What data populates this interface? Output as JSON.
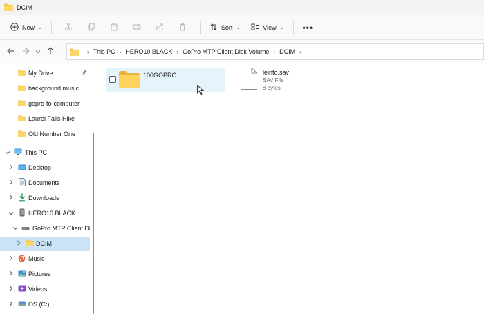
{
  "window": {
    "title": "DCIM"
  },
  "toolbar": {
    "new_label": "New",
    "sort_label": "Sort",
    "view_label": "View",
    "more_label": "•••"
  },
  "address": {
    "crumbs": [
      "This PC",
      "HERO10 BLACK",
      "GoPro MTP Client Disk Volume",
      "DCIM"
    ]
  },
  "sidebar": {
    "items": [
      {
        "label": "My Drive",
        "icon": "folder-icon",
        "pinned": true
      },
      {
        "label": "background music",
        "icon": "folder-icon"
      },
      {
        "label": "gopro-to-computer",
        "icon": "folder-icon"
      },
      {
        "label": "Laurel Falls Hike",
        "icon": "folder-icon"
      },
      {
        "label": "Old Number One",
        "icon": "folder-icon"
      },
      {
        "label": "This PC",
        "icon": "pc-icon",
        "expanded": true
      },
      {
        "label": "Desktop",
        "icon": "desktop-icon"
      },
      {
        "label": "Documents",
        "icon": "documents-icon"
      },
      {
        "label": "Downloads",
        "icon": "downloads-icon"
      },
      {
        "label": "HERO10 BLACK",
        "icon": "device-icon",
        "expanded": true
      },
      {
        "label": "GoPro MTP Client Disk",
        "icon": "drive-icon",
        "expanded": true
      },
      {
        "label": "DCIM",
        "icon": "folder-icon",
        "selected": true
      },
      {
        "label": "Music",
        "icon": "music-icon"
      },
      {
        "label": "Pictures",
        "icon": "pictures-icon"
      },
      {
        "label": "Videos",
        "icon": "videos-icon"
      },
      {
        "label": "OS (C:)",
        "icon": "disk-icon"
      }
    ]
  },
  "content": {
    "items": [
      {
        "name": "100GOPRO",
        "type": "folder",
        "hovered": true
      },
      {
        "name": "leinfo.sav",
        "type_label": "SAV File",
        "size": "8 bytes"
      }
    ]
  },
  "colors": {
    "selection": "#cce4f7",
    "hover": "#e5f3fb",
    "folder": "#f6c94f"
  }
}
